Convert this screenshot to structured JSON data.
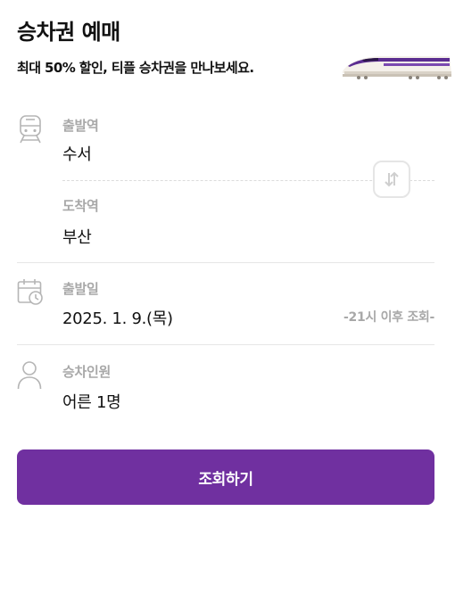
{
  "header": {
    "title": "승차권 예매",
    "subtitle": "최대 50% 할인, 티플 승차권을 만나보세요."
  },
  "train_illustration": {
    "icon": "high-speed-train-illustration",
    "accent_color": "#5b2d91"
  },
  "departure": {
    "label": "출발역",
    "value": "수서",
    "icon": "train-icon"
  },
  "arrival": {
    "label": "도착역",
    "value": "부산"
  },
  "swap": {
    "icon": "swap-arrows-icon"
  },
  "date": {
    "label": "출발일",
    "value": "2025. 1. 9.(목)",
    "note": "-21시 이후 조회-",
    "icon": "calendar-clock-icon"
  },
  "passengers": {
    "label": "승차인원",
    "value": "어른 1명",
    "icon": "person-icon"
  },
  "search_button": {
    "label": "조회하기",
    "color": "#7030a0"
  }
}
